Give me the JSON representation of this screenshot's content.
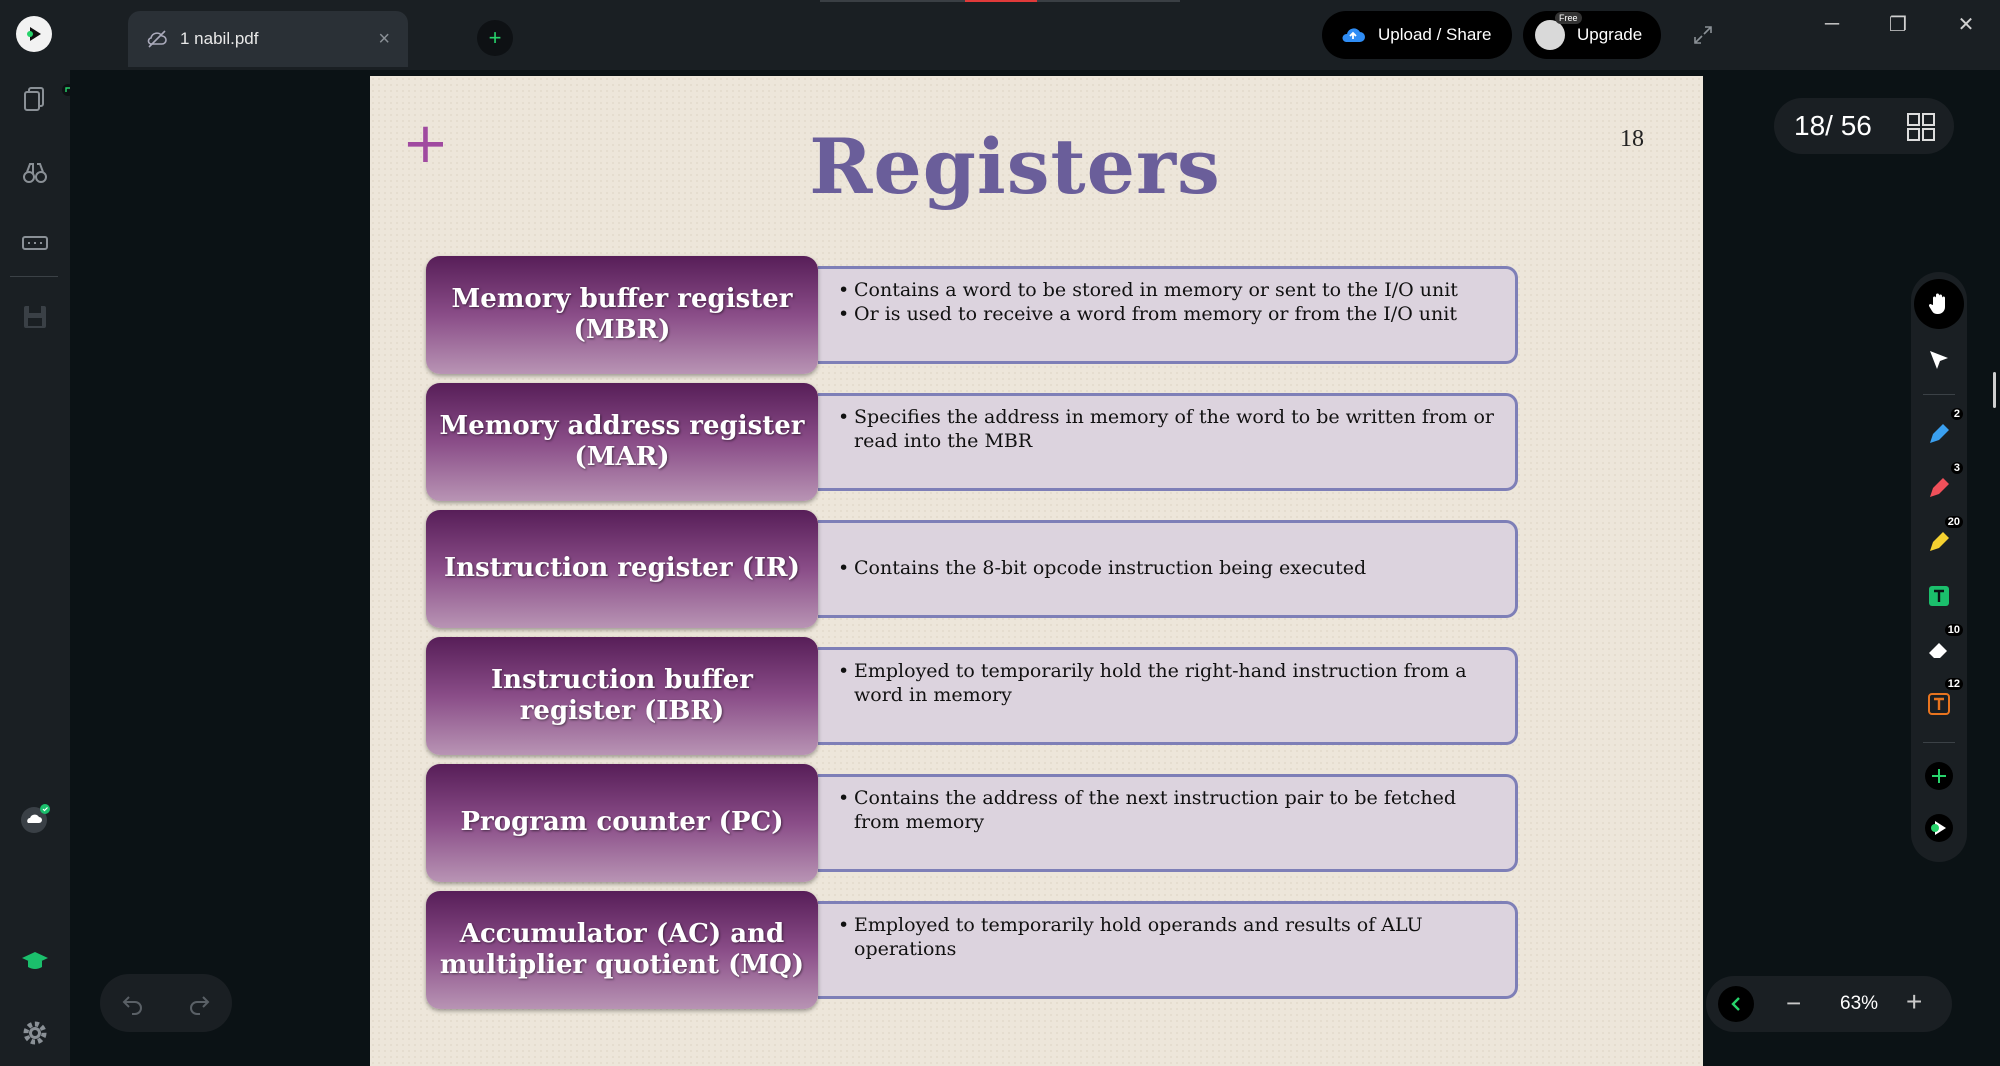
{
  "window": {
    "tab_title": "1 nabil.pdf",
    "upload_label": "Upload / Share",
    "upgrade_label": "Upgrade",
    "free_badge": "Free"
  },
  "slide": {
    "title": "Registers",
    "page_number_label": "18",
    "rows": [
      {
        "name": "Memory buffer register (MBR)",
        "desc": [
          "Contains a word to be stored in memory or sent to the  I/O unit",
          "Or is used to receive a word from memory or from the I/O unit"
        ]
      },
      {
        "name": "Memory address register (MAR)",
        "desc": [
          "Specifies the address in memory of the word to be written from or read into the MBR"
        ]
      },
      {
        "name": "Instruction register (IR)",
        "desc": [
          "Contains the 8-bit opcode instruction being executed"
        ]
      },
      {
        "name": "Instruction buffer register (IBR)",
        "desc": [
          "Employed to temporarily hold the right-hand instruction from a word in memory"
        ]
      },
      {
        "name": "Program counter (PC)",
        "desc": [
          "Contains the address of the next instruction pair to be fetched from memory"
        ]
      },
      {
        "name": "Accumulator (AC) and multiplier quotient (MQ)",
        "desc": [
          "Employed to temporarily hold operands and results of ALU operations"
        ]
      }
    ]
  },
  "viewer": {
    "page_counter": "18/ 56",
    "zoom": "63%"
  },
  "toolbar": {
    "pen_blue_count": "2",
    "pen_red_count": "3",
    "highlighter_count": "20",
    "eraser_count": "10",
    "text_box_count": "12"
  },
  "colors": {
    "accent_green": "#27d36b",
    "title_purple": "#6a5e9a",
    "register_purple": "#571e58"
  }
}
